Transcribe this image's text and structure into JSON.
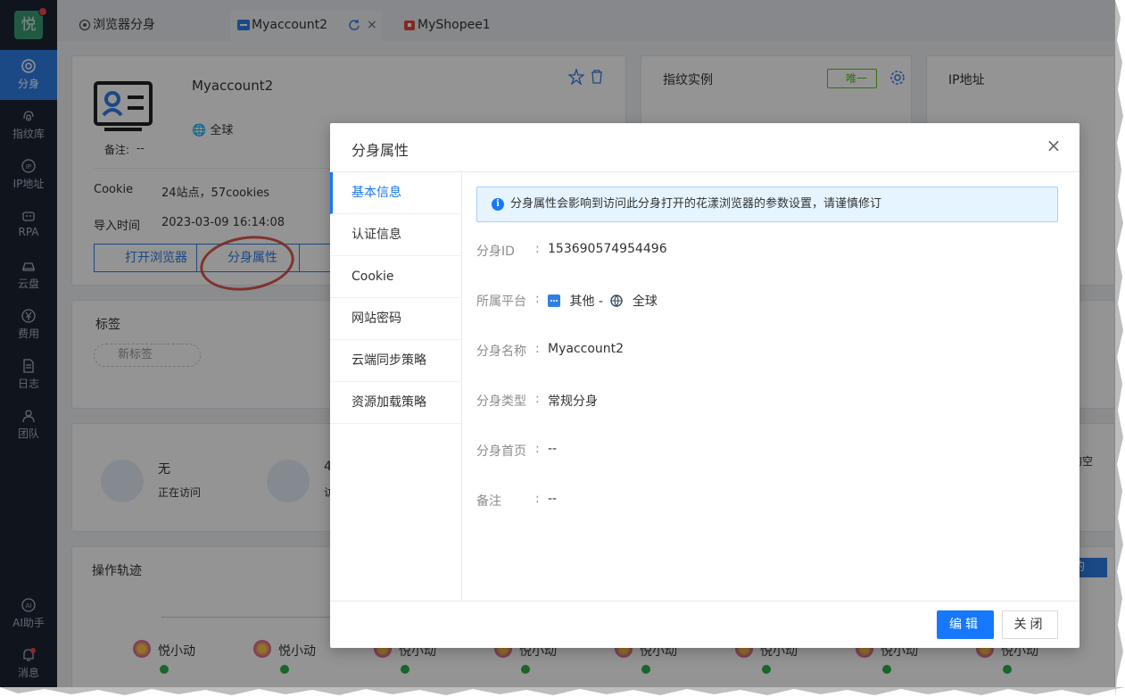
{
  "sidebar": {
    "logo": "悦",
    "items": [
      {
        "label": "分身",
        "icon": "chrome-icon",
        "active": true
      },
      {
        "label": "指纹库",
        "icon": "fingerprint-icon"
      },
      {
        "label": "IP地址",
        "icon": "ip-icon"
      },
      {
        "label": "RPA",
        "icon": "robot-icon"
      },
      {
        "label": "云盘",
        "icon": "cloud-disk-icon"
      },
      {
        "label": "费用",
        "icon": "yen-icon"
      },
      {
        "label": "日志",
        "icon": "document-icon"
      },
      {
        "label": "团队",
        "icon": "team-icon"
      },
      {
        "label": "AI助手",
        "icon": "ai-icon"
      },
      {
        "label": "消息",
        "icon": "bell-icon"
      }
    ]
  },
  "tabs": [
    {
      "label": "浏览器分身",
      "icon": "chrome-icon"
    },
    {
      "label": "Myaccount2",
      "icon": "account-icon",
      "active": true
    },
    {
      "label": "MyShopee1",
      "icon": "shop-icon"
    }
  ],
  "account": {
    "name": "Myaccount2",
    "region": "全球",
    "note_label": "备注:",
    "note_value": "--",
    "cookie_label": "Cookie",
    "cookie_value": "24站点，57cookies",
    "import_label": "导入时间",
    "import_value": "2023-03-09 16:14:08",
    "open_browser": "打开浏览器",
    "properties": "分身属性"
  },
  "fingerprint_card": {
    "title": "指纹实例",
    "badge": "唯一"
  },
  "ip_card": {
    "title": "IP地址"
  },
  "tags": {
    "title": "标签",
    "new_tag": "新标签"
  },
  "stats": {
    "visiting_value": "无",
    "visiting_label": "正在访问",
    "views_value": "4",
    "views_label": "访",
    "right_fragment": "均空"
  },
  "trail": {
    "title": "操作轨迹",
    "right_fragment": "的",
    "user": "悦小动",
    "count": 8
  },
  "modal": {
    "title": "分身属性",
    "close": "×",
    "menu": [
      "基本信息",
      "认证信息",
      "Cookie",
      "网站密码",
      "云端同步策略",
      "资源加载策略"
    ],
    "notice": "分身属性会影响到访问此分身打开的花漾浏览器的参数设置，请谨慎修订",
    "fields": [
      {
        "label": "分身ID",
        "value": "153690574954496"
      },
      {
        "label": "所属平台",
        "value": "其他 -",
        "value2": "全球"
      },
      {
        "label": "分身名称",
        "value": "Myaccount2"
      },
      {
        "label": "分身类型",
        "value": "常规分身"
      },
      {
        "label": "分身首页",
        "value": "--"
      },
      {
        "label": "备注",
        "value": "--"
      }
    ],
    "colon": ":",
    "edit": "编辑",
    "close_button": "关闭"
  },
  "colors": {
    "sidebar": "#1c2433",
    "accent": "#1677ff",
    "annotation": "#d9453c"
  }
}
